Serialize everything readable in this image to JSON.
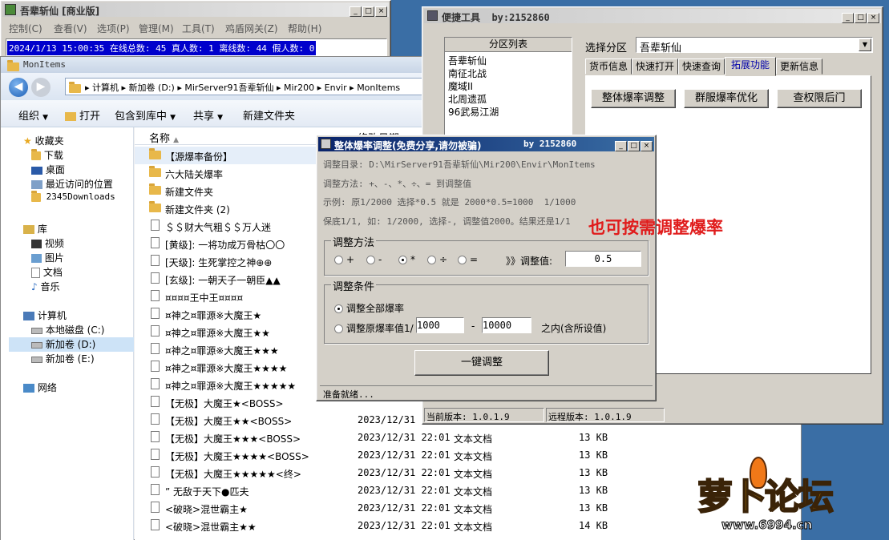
{
  "main_window": {
    "title": "吾辈斩仙 [商业版]",
    "menus": [
      "控制(C)",
      "查看(V)",
      "选项(P)",
      "管理(M)",
      "工具(T)",
      "鸡盾网关(Z)",
      "帮助(H)"
    ],
    "status": "2024/1/13 15:00:35 在线总数: 45 真人数: 1 离线数: 44 假人数: 0"
  },
  "explorer": {
    "title": "MonItems",
    "breadcrumb": [
      "计算机",
      "新加卷 (D:)",
      "MirServer91吾辈斩仙",
      "Mir200",
      "Envir",
      "MonItems"
    ],
    "toolbar": [
      "组织",
      "打开",
      "包含到库中",
      "共享",
      "新建文件夹"
    ],
    "nav": {
      "favorites_label": "收藏夹",
      "favorites": [
        "下载",
        "桌面",
        "最近访问的位置",
        "2345Downloads"
      ],
      "library_label": "库",
      "library": [
        "视频",
        "图片",
        "文档",
        "音乐"
      ],
      "computer_label": "计算机",
      "drives": [
        "本地磁盘 (C:)",
        "新加卷 (D:)",
        "新加卷 (E:)"
      ],
      "network_label": "网络"
    },
    "columns": {
      "name": "名称",
      "date": "修改日期"
    },
    "folders": [
      "【源爆率备份】",
      "六大陆关爆率",
      "新建文件夹",
      "新建文件夹 (2)"
    ],
    "files": [
      {
        "name": "＄＄财大气粗＄＄万人迷",
        "date": "",
        "type": "",
        "size": ""
      },
      {
        "name": "[黄级]: 一将功成万骨枯〇〇",
        "date": "",
        "type": "",
        "size": ""
      },
      {
        "name": "[天级]: 生死掌控之神⊕⊕",
        "date": "",
        "type": "",
        "size": ""
      },
      {
        "name": "[玄级]: 一朝天子一朝臣▲▲",
        "date": "",
        "type": "",
        "size": ""
      },
      {
        "name": "¤¤¤¤王中王¤¤¤¤",
        "date": "",
        "type": "",
        "size": ""
      },
      {
        "name": "¤神之¤罪源※大魔王★",
        "date": "",
        "type": "",
        "size": ""
      },
      {
        "name": "¤神之¤罪源※大魔王★★",
        "date": "",
        "type": "",
        "size": ""
      },
      {
        "name": "¤神之¤罪源※大魔王★★★",
        "date": "",
        "type": "",
        "size": ""
      },
      {
        "name": "¤神之¤罪源※大魔王★★★★",
        "date": "",
        "type": "",
        "size": ""
      },
      {
        "name": "¤神之¤罪源※大魔王★★★★★",
        "date": "",
        "type": "",
        "size": ""
      },
      {
        "name": "【无极】大魔王★<BOSS>",
        "date": "",
        "type": "",
        "size": ""
      },
      {
        "name": "【无极】大魔王★★<BOSS>",
        "date": "2023/12/31 22:01",
        "type": "",
        "size": ""
      },
      {
        "name": "【无极】大魔王★★★<BOSS>",
        "date": "2023/12/31 22:01",
        "type": "文本文档",
        "size": "13 KB"
      },
      {
        "name": "【无极】大魔王★★★★<BOSS>",
        "date": "2023/12/31 22:01",
        "type": "文本文档",
        "size": "13 KB"
      },
      {
        "name": "【无极】大魔王★★★★★<终>",
        "date": "2023/12/31 22:01",
        "type": "文本文档",
        "size": "13 KB"
      },
      {
        "name": "” 无敌于天下●匹夫",
        "date": "2023/12/31 22:01",
        "type": "文本文档",
        "size": "13 KB"
      },
      {
        "name": "<破晓>混世霸主★",
        "date": "2023/12/31 22:01",
        "type": "文本文档",
        "size": "13 KB"
      },
      {
        "name": "<破晓>混世霸主★★",
        "date": "2023/12/31 22:01",
        "type": "文本文档",
        "size": "14 KB"
      }
    ]
  },
  "tools_window": {
    "title": "便捷工具  by:2152860",
    "partition_list_header": "分区列表",
    "partitions": [
      "吾辈斩仙",
      "南征北战",
      "魔域II",
      "北周遗孤",
      "96武易江湖"
    ],
    "select_label": "选择分区",
    "select_value": "吾辈斩仙",
    "tabs": [
      "货币信息",
      "快速打开",
      "快速查询",
      "拓展功能",
      "更新信息"
    ],
    "buttons": [
      "整体爆率调整",
      "群服爆率优化",
      "查权限后门"
    ],
    "current_version": "当前版本: 1.0.1.9",
    "remote_version": "远程版本: 1.0.1.9"
  },
  "dialog": {
    "title": "整体爆率调整(免费分享,请勿被骗)",
    "author": "by 2152860",
    "dir": "调整目录: D:\\MirServer91吾辈斩仙\\Mir200\\Envir\\MonItems",
    "method_desc": "调整方法: +、-、*、÷、= 到调整值",
    "example": "示例: 原1/2000 选择*0.5 就是 2000*0.5=1000  1/1000",
    "keep": "保底1/1, 如: 1/2000, 选择-, 调整值2000。结果还是1/1",
    "method_group": "调整方法",
    "ops": [
      "+",
      "-",
      "*",
      "÷",
      "="
    ],
    "value_label": "》》调整值:",
    "value": "0.5",
    "cond_group": "调整条件",
    "cond_all": "调整全部爆率",
    "cond_range": "调整原爆率值1/",
    "range_from": "1000",
    "range_dash": "-",
    "range_to": "10000",
    "range_suffix": "之内(含所设值)",
    "apply_button": "一键调整",
    "status": "准备就绪..."
  },
  "annotation": "也可按需调整爆率",
  "watermark": {
    "brand": "萝卜论坛",
    "site": "www.6994.cn"
  },
  "colors": {
    "annotation": "#e01c1c",
    "status_highlight": "#0000cc",
    "title_active": "#0a246a"
  }
}
